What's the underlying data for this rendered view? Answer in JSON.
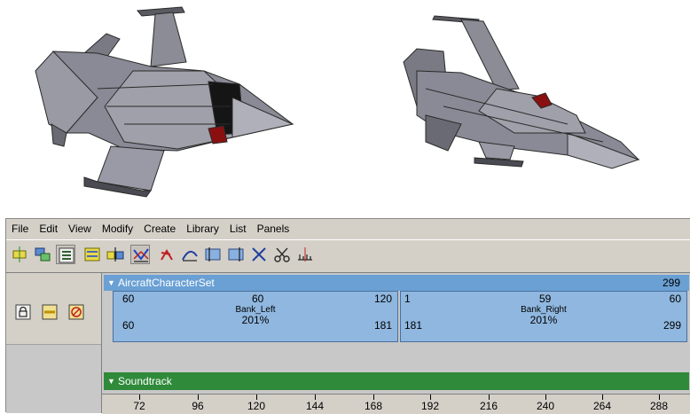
{
  "menu": [
    "File",
    "Edit",
    "View",
    "Modify",
    "Create",
    "Library",
    "List",
    "Panels"
  ],
  "toolbar_icons": [
    "new-character-set-icon",
    "new-subcharacter-icon",
    "outliner-icon",
    "create-clip-icon",
    "split-clip-icon",
    "graph-editor-icon",
    "motion-trail-icon",
    "curve-icon",
    "pose-icon",
    "insert-icon",
    "trim-icon",
    "cut-icon",
    "ruler-icon"
  ],
  "left_panel_icons": [
    "lock-icon",
    "mute-icon",
    "disable-icon"
  ],
  "character_set": {
    "name": "AircraftCharacterSet",
    "frame_count": "299",
    "clips": [
      {
        "start": "60",
        "mid": "60",
        "end": "120",
        "name": "Bank_Left",
        "source_start": "60",
        "scale": "201%",
        "source_end": "181"
      },
      {
        "start": "1",
        "mid": "59",
        "end": "60",
        "name": "Bank_Right",
        "source_start": "181",
        "scale": "201%",
        "source_end": "299"
      }
    ]
  },
  "soundtrack": {
    "name": "Soundtrack"
  },
  "ruler": [
    "72",
    "96",
    "120",
    "144",
    "168",
    "192",
    "216",
    "240",
    "264",
    "288"
  ],
  "colors": {
    "charset_header": "#6aa0d4",
    "clip": "#8fb7df",
    "soundtrack": "#2f8a3a",
    "panel": "#d4d0c8"
  }
}
